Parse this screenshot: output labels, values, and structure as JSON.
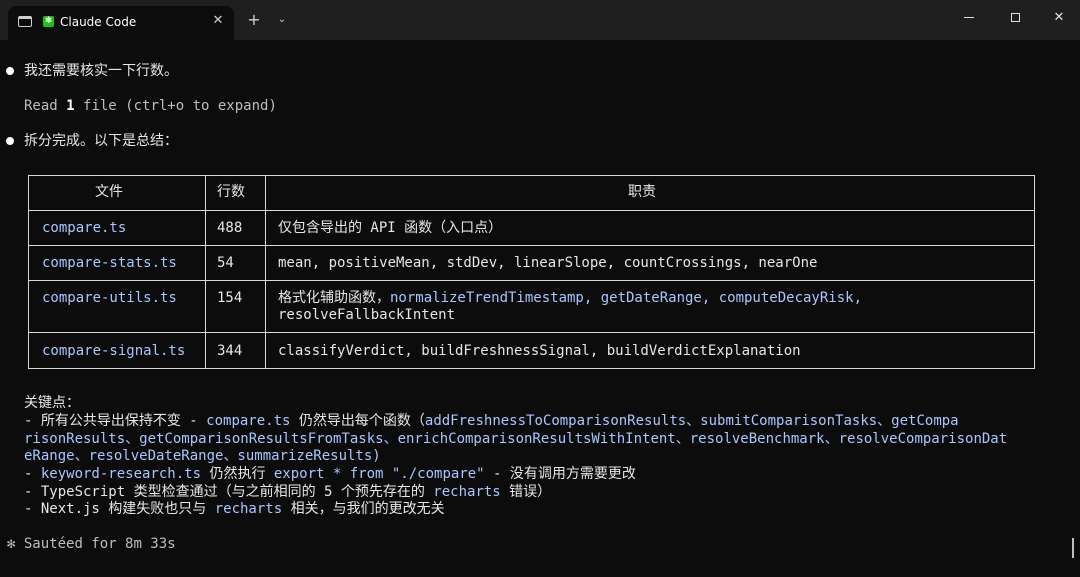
{
  "window": {
    "tab_title": "Claude Code",
    "tab_close": "✕",
    "new_tab": "+",
    "dropdown": "⌄",
    "close": "✕"
  },
  "messages": {
    "m1": "我还需要核实一下行数。",
    "read_prefix": "Read ",
    "read_count": "1",
    "read_suffix": " file (ctrl+o to expand)",
    "m2": "拆分完成。以下是总结："
  },
  "table": {
    "headers": [
      "文件",
      "行数",
      "职责"
    ],
    "rows": [
      {
        "file": "compare.ts",
        "lines": "488",
        "role_prefix": "仅包含导出的 API 函数（入口点）",
        "role_code": ""
      },
      {
        "file": "compare-stats.ts",
        "lines": "54",
        "role_code": "mean, positiveMean, stdDev, linearSlope, countCrossings, nearOne"
      },
      {
        "file": "compare-utils.ts",
        "lines": "154",
        "role_prefix": "格式化辅助函数，",
        "role_code": "normalizeTrendTimestamp, getDateRange, computeDecayRisk,",
        "role_code2": "resolveFallbackIntent"
      },
      {
        "file": "compare-signal.ts",
        "lines": "344",
        "role_code": "classifyVerdict, buildFreshnessSignal, buildVerdictExplanation"
      }
    ]
  },
  "keypoints": {
    "title": "关键点：",
    "k1_a": "- 所有公共导出保持不变 - ",
    "k1_code": "compare.ts",
    "k1_b": " 仍然导出每个函数（",
    "k1_c": "addFreshnessToComparisonResults、submitComparisonTasks、getCompa",
    "k1_d": "risonResults、getComparisonResultsFromTasks、enrichComparisonResultsWithIntent、resolveBenchmark、resolveComparisonDat",
    "k1_e": "eRange、resolveDateRange、summarizeResults)",
    "k2_a": "- ",
    "k2_code": "keyword-research.ts",
    "k2_b": " 仍然执行 ",
    "k2_code2": "export * from \"./compare\"",
    "k2_c": " - 没有调用方需要更改",
    "k3_a": "- TypeScript 类型检查通过（与之前相同的 5 个预先存在的 ",
    "k3_code": "recharts",
    "k3_b": " 错误）",
    "k4_a": "- Next.js 构建失败也只与 ",
    "k4_code": "recharts",
    "k4_b": " 相关，与我们的更改无关"
  },
  "status": {
    "spinner": "✻",
    "text": " Sautéed for 8m 33s"
  }
}
